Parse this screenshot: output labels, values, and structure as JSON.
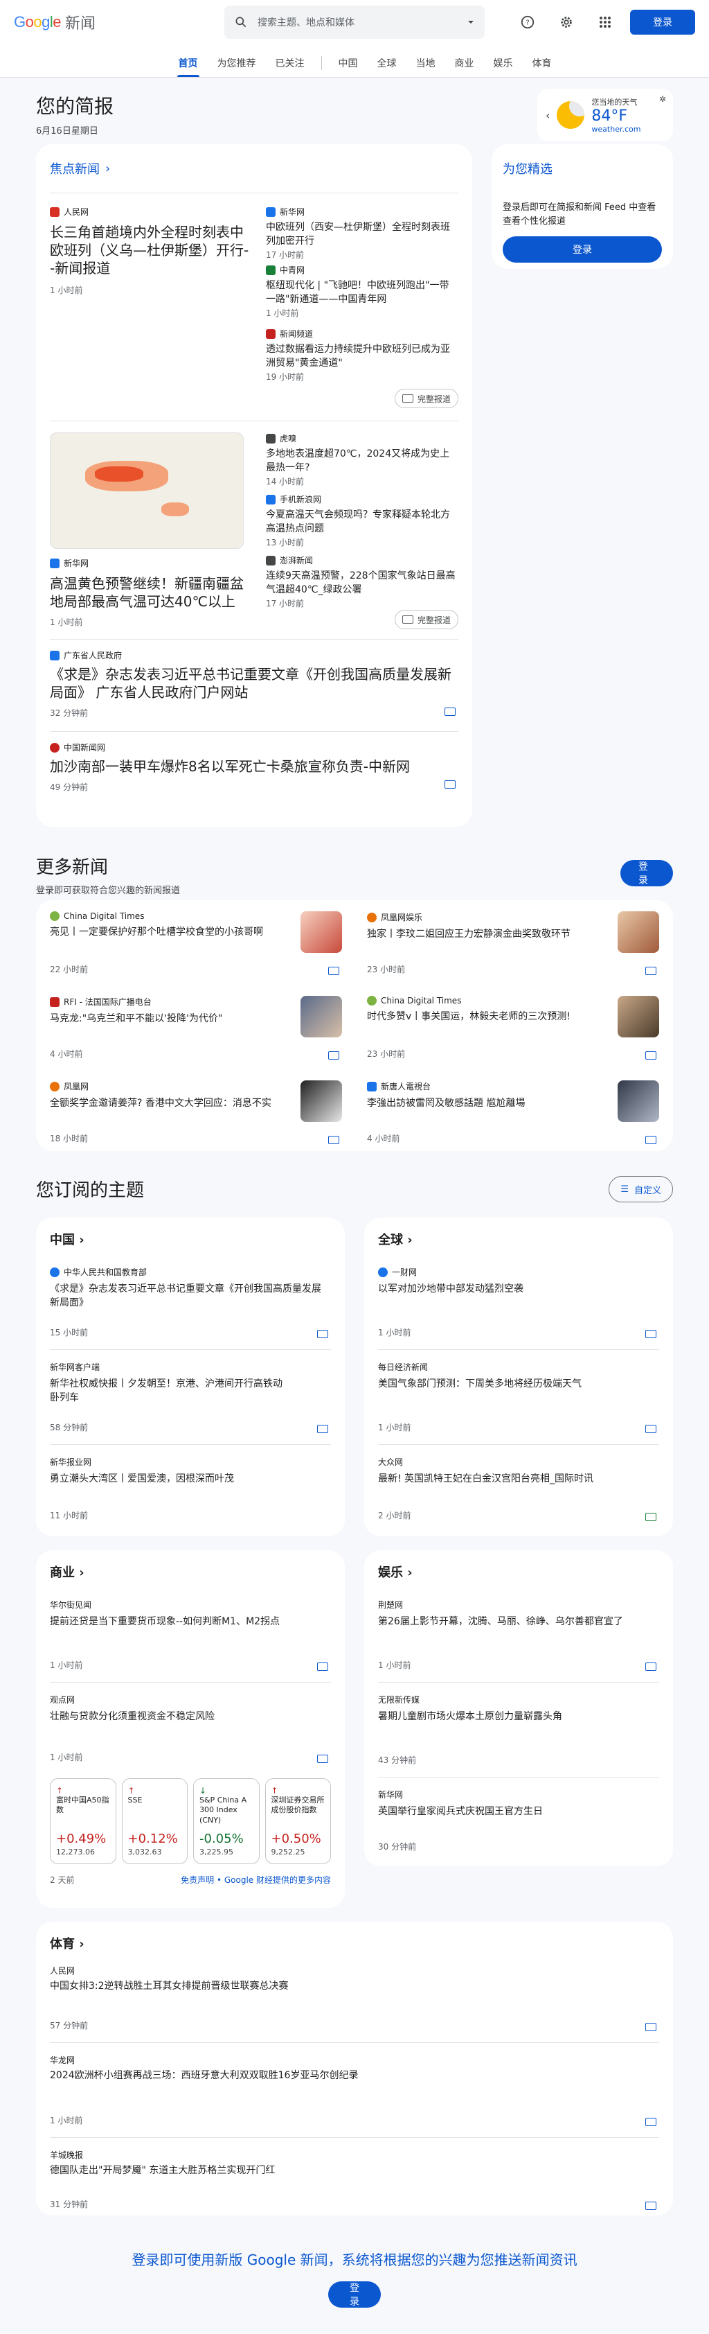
{
  "header": {
    "logo_google": "Google",
    "logo_news": "新闻",
    "search_placeholder": "搜索主题、地点和媒体",
    "login": "登录"
  },
  "nav": {
    "tabs": [
      "首页",
      "为您推荐",
      "已关注",
      "中国",
      "全球",
      "当地",
      "商业",
      "娱乐",
      "体育"
    ]
  },
  "briefing": {
    "title": "您的简报",
    "date": "6月16日星期日",
    "weather_label": "您当地的天气",
    "temp": "84°F",
    "source": "weather.com"
  },
  "headlines": {
    "title": "焦点新闻",
    "story1": {
      "src": "人民网",
      "title": "长三角首趟境内外全程时刻表中欧班列（义乌—杜伊斯堡）开行--新闻报道",
      "time": "1 小时前",
      "side": [
        {
          "src": "新华网",
          "title": "中欧班列（西安—杜伊斯堡）全程时刻表班列加密开行",
          "time": "17 小时前"
        },
        {
          "src": "中青网",
          "title": "枢纽现代化 | \"飞驰吧！中欧班列跑出\"一带一路\"新通道——中国青年网",
          "time": "1 小时前"
        },
        {
          "src": "新闻频道",
          "title": "透过数据看运力持续提升中欧班列已成为亚洲贸易\"黄金通道\"",
          "time": "19 小时前"
        }
      ]
    },
    "story2": {
      "src": "新华网",
      "title": "高温黄色预警继续！新疆南疆盆地局部最高气温可达40℃以上",
      "time": "1 小时前",
      "side": [
        {
          "src": "虎嗅",
          "title": "多地地表温度超70℃，2024又将成为史上最热一年?",
          "time": "14 小时前"
        },
        {
          "src": "手机新浪网",
          "title": "今夏高温天气会频现吗？专家释疑本轮北方高温热点问题",
          "time": "13 小时前"
        },
        {
          "src": "澎湃新闻",
          "title": "连续9天高温预警，228个国家气象站日最高气温超40℃_绿政公署",
          "time": "17 小时前"
        }
      ]
    },
    "full": "完整报道",
    "story3": {
      "src": "广东省人民政府",
      "title": "《求是》杂志发表习近平总书记重要文章《开创我国高质量发展新局面》 广东省人民政府门户网站",
      "time": "32 分钟前"
    },
    "story4": {
      "src": "中国新闻网",
      "title": "加沙南部一装甲车爆炸8名以军死亡卡桑旅宣称负责-中新网",
      "time": "49 分钟前"
    }
  },
  "picks": {
    "title": "为您精选",
    "desc": "登录后即可在简报和新闻 Feed 中查看查看个性化报道",
    "login": "登录"
  },
  "more": {
    "title": "更多新闻",
    "sub": "登录即可获取符合您兴趣的新闻报道",
    "login": "登录",
    "items": [
      {
        "src": "China Digital Times",
        "title": "亮见丨一定要保护好那个吐槽学校食堂的小孩哥啊",
        "time": "22 小时前"
      },
      {
        "src": "凤凰网娱乐",
        "title": "独家丨李玟二姐回应王力宏静演金曲奖致敬环节",
        "time": "23 小时前"
      },
      {
        "src": "RFI - 法国国际广播电台",
        "title": "马克龙:\"乌克兰和平不能以'投降'为代价\"",
        "time": "4 小时前"
      },
      {
        "src": "China Digital Times",
        "title": "时代多赞ⅴ丨事关国运，林毅夫老师的三次预测!",
        "time": "23 小时前"
      },
      {
        "src": "凤凰网",
        "title": "全额奖学金邀请姜萍? 香港中文大学回应：消息不实",
        "time": "18 小时前"
      },
      {
        "src": "新唐人電視台",
        "title": "李強出訪被雷罔及敏感話題 尴尬離場",
        "time": "4 小时前"
      }
    ]
  },
  "topics": {
    "title": "您订阅的主题",
    "customize": "自定义",
    "china": {
      "title": "中国",
      "items": [
        {
          "src": "中华人民共和国教育部",
          "title": "《求是》杂志发表习近平总书记重要文章《开创我国高质量发展新局面》",
          "time": "15 小时前"
        },
        {
          "src": "新华网客户端",
          "title": "新华社权威快报丨夕发朝至！京港、沪港间开行高铁动卧列车",
          "time": "58 分钟前"
        },
        {
          "src": "新华报业网",
          "title": "勇立潮头大湾区丨爱国爱澳，因根深而叶茂",
          "time": "11 小时前"
        }
      ]
    },
    "world": {
      "title": "全球",
      "items": [
        {
          "src": "一财网",
          "title": "以军对加沙地带中部发动猛烈空袭",
          "time": "1 小时前"
        },
        {
          "src": "每日经济新闻",
          "title": "美国气象部门预测：下周美多地将经历极端天气",
          "time": "1 小时前"
        },
        {
          "src": "大众网",
          "title": "最新! 英国凯特王妃在白金汉宫阳台亮相_国际时讯",
          "time": "2 小时前"
        }
      ]
    },
    "business": {
      "title": "商业",
      "items": [
        {
          "src": "华尔街见闻",
          "title": "提前还贷是当下重要货币现象--如何判断M1、M2拐点",
          "time": "1 小时前"
        },
        {
          "src": "观点网",
          "title": "壮融与贷款分化须重视资金不稳定风险",
          "time": "1 小时前"
        }
      ],
      "markets": [
        {
          "name": "富时中国A50指数",
          "pct": "+0.49%",
          "val": "12,273.06"
        },
        {
          "name": "SSE",
          "pct": "+0.12%",
          "val": "3,032.63"
        },
        {
          "name": "S&P China A 300 Index (CNY)",
          "pct": "-0.05%",
          "val": "3,225.95"
        },
        {
          "name": "深圳证券交易所成份股价指数",
          "pct": "+0.50%",
          "val": "9,252.25"
        }
      ],
      "mtime": "2 天前",
      "disclaimer": "免责声明 • Google 财经提供的更多内容"
    },
    "ent": {
      "title": "娱乐",
      "items": [
        {
          "src": "荆楚网",
          "title": "第26届上影节开幕，沈腾、马丽、徐峥、乌尔善都官宣了",
          "time": "1 小时前"
        },
        {
          "src": "无限新传媒",
          "title": "暑期儿童剧市场火爆本土原创力量崭露头角",
          "time": "43 分钟前"
        },
        {
          "src": "新华网",
          "title": "英国举行皇家阅兵式庆祝国王官方生日",
          "time": "30 分钟前"
        }
      ]
    },
    "sports": {
      "title": "体育",
      "items": [
        {
          "src": "人民网",
          "title": "中国女排3:2逆转战胜土耳其女排提前晋级世联赛总决赛",
          "time": "57 分钟前"
        },
        {
          "src": "华龙网",
          "title": "2024欧洲杯小组赛再战三场：西班牙意大利双双取胜16岁亚马尔创纪录",
          "time": "1 小时前"
        },
        {
          "src": "羊城晚报",
          "title": "德国队走出\"开局梦魇\" 东道主大胜苏格兰实现开门红",
          "time": "31 分钟前"
        }
      ]
    }
  },
  "footer": {
    "text": "登录即可使用新版 Google 新闻，系统将根据您的兴趣为您推送新闻资讯",
    "login": "登录"
  },
  "colors": {
    "accent": "#0b57d0",
    "positive": "#c5221f",
    "negative": "#137333"
  }
}
